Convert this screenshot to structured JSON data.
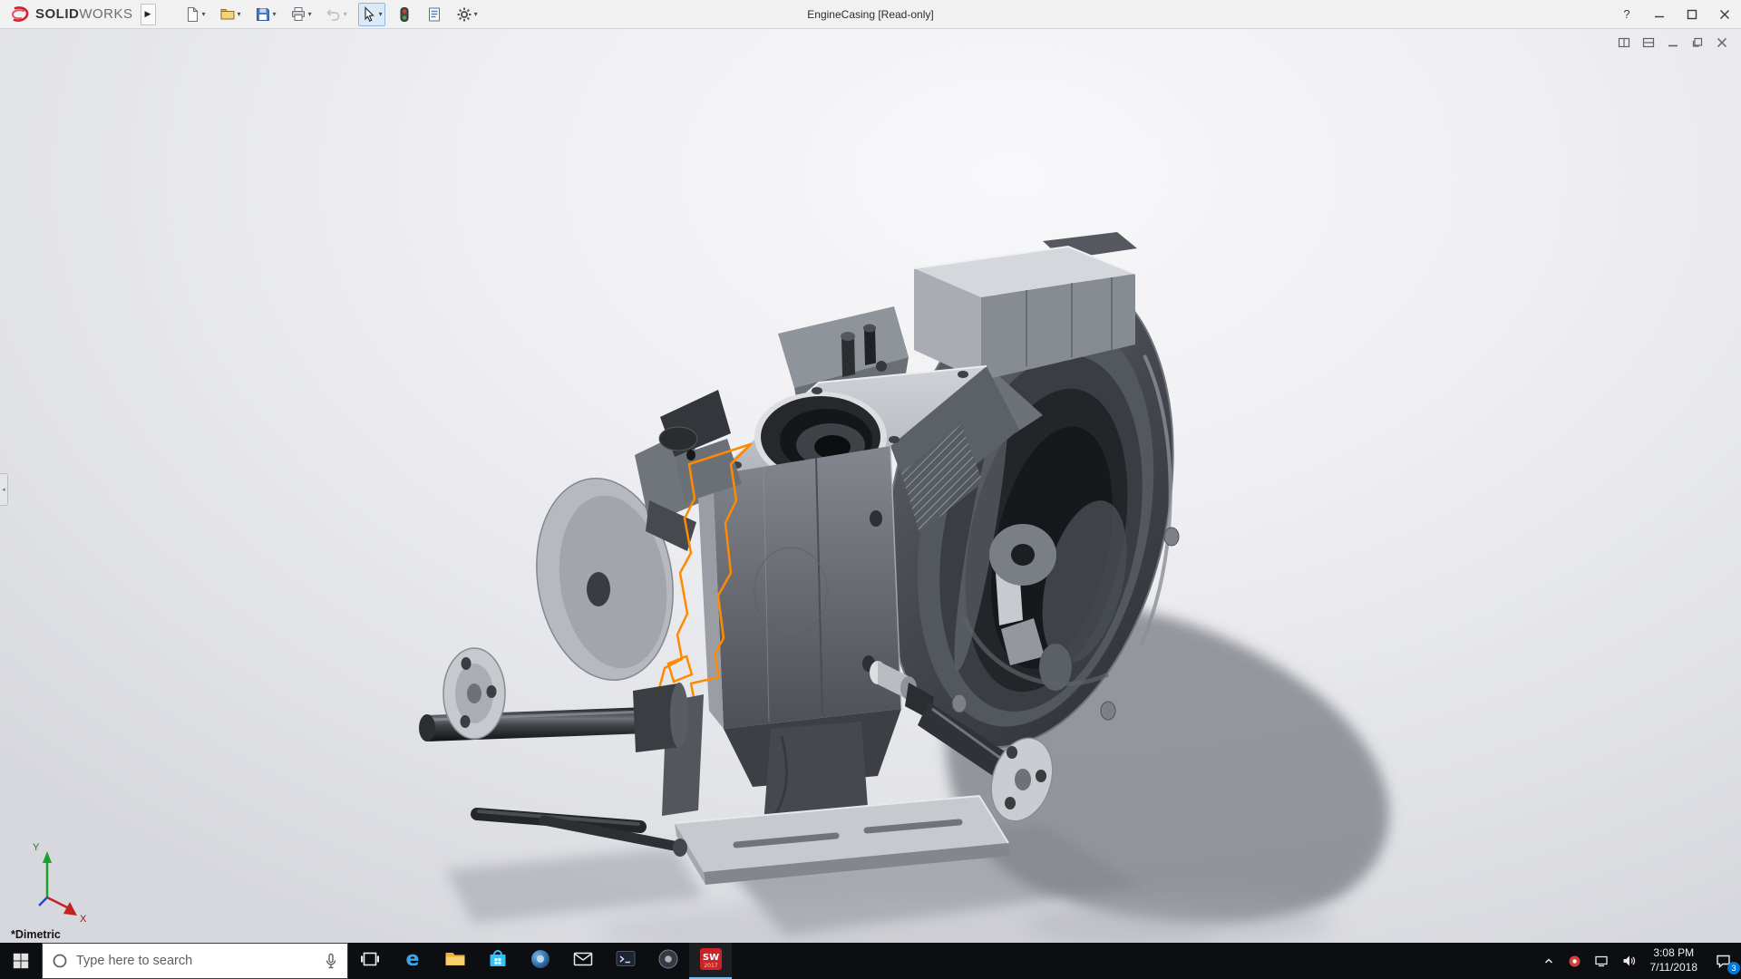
{
  "window": {
    "brand_bold": "SOLID",
    "brand_light": "WORKS",
    "title": "EngineCasing [Read-only]",
    "help_glyph": "?"
  },
  "menubar": {
    "buttons": [
      {
        "id": "new",
        "dropdown": true
      },
      {
        "id": "open",
        "dropdown": true
      },
      {
        "id": "save",
        "dropdown": true
      },
      {
        "id": "print",
        "dropdown": true
      },
      {
        "id": "undo",
        "dropdown": true,
        "disabled": true
      },
      {
        "id": "select",
        "dropdown": true,
        "active": true
      },
      {
        "id": "rebuild",
        "dropdown": false
      },
      {
        "id": "file-properties",
        "dropdown": false
      },
      {
        "id": "options",
        "dropdown": true
      }
    ]
  },
  "viewport": {
    "view_label": "*Dimetric",
    "triad": {
      "x": "X",
      "y": "Y"
    },
    "doc_controls": [
      "split-view",
      "pane-view",
      "minimize-doc",
      "restore-doc",
      "close-doc"
    ]
  },
  "taskbar": {
    "search": {
      "placeholder": "Type here to search"
    },
    "apps": [
      {
        "id": "task-view"
      },
      {
        "id": "edge"
      },
      {
        "id": "file-explorer"
      },
      {
        "id": "store"
      },
      {
        "id": "browser"
      },
      {
        "id": "mail"
      },
      {
        "id": "terminal"
      },
      {
        "id": "media"
      },
      {
        "id": "solidworks",
        "active": true,
        "year": "2017"
      }
    ],
    "tray": {
      "time": "3:08 PM",
      "date": "7/11/2018",
      "notification_count": "3"
    }
  },
  "colors": {
    "sketch_orange": "#ff8a00",
    "brand_red": "#d5202e",
    "taskbar_bg": "#0c0e12"
  }
}
